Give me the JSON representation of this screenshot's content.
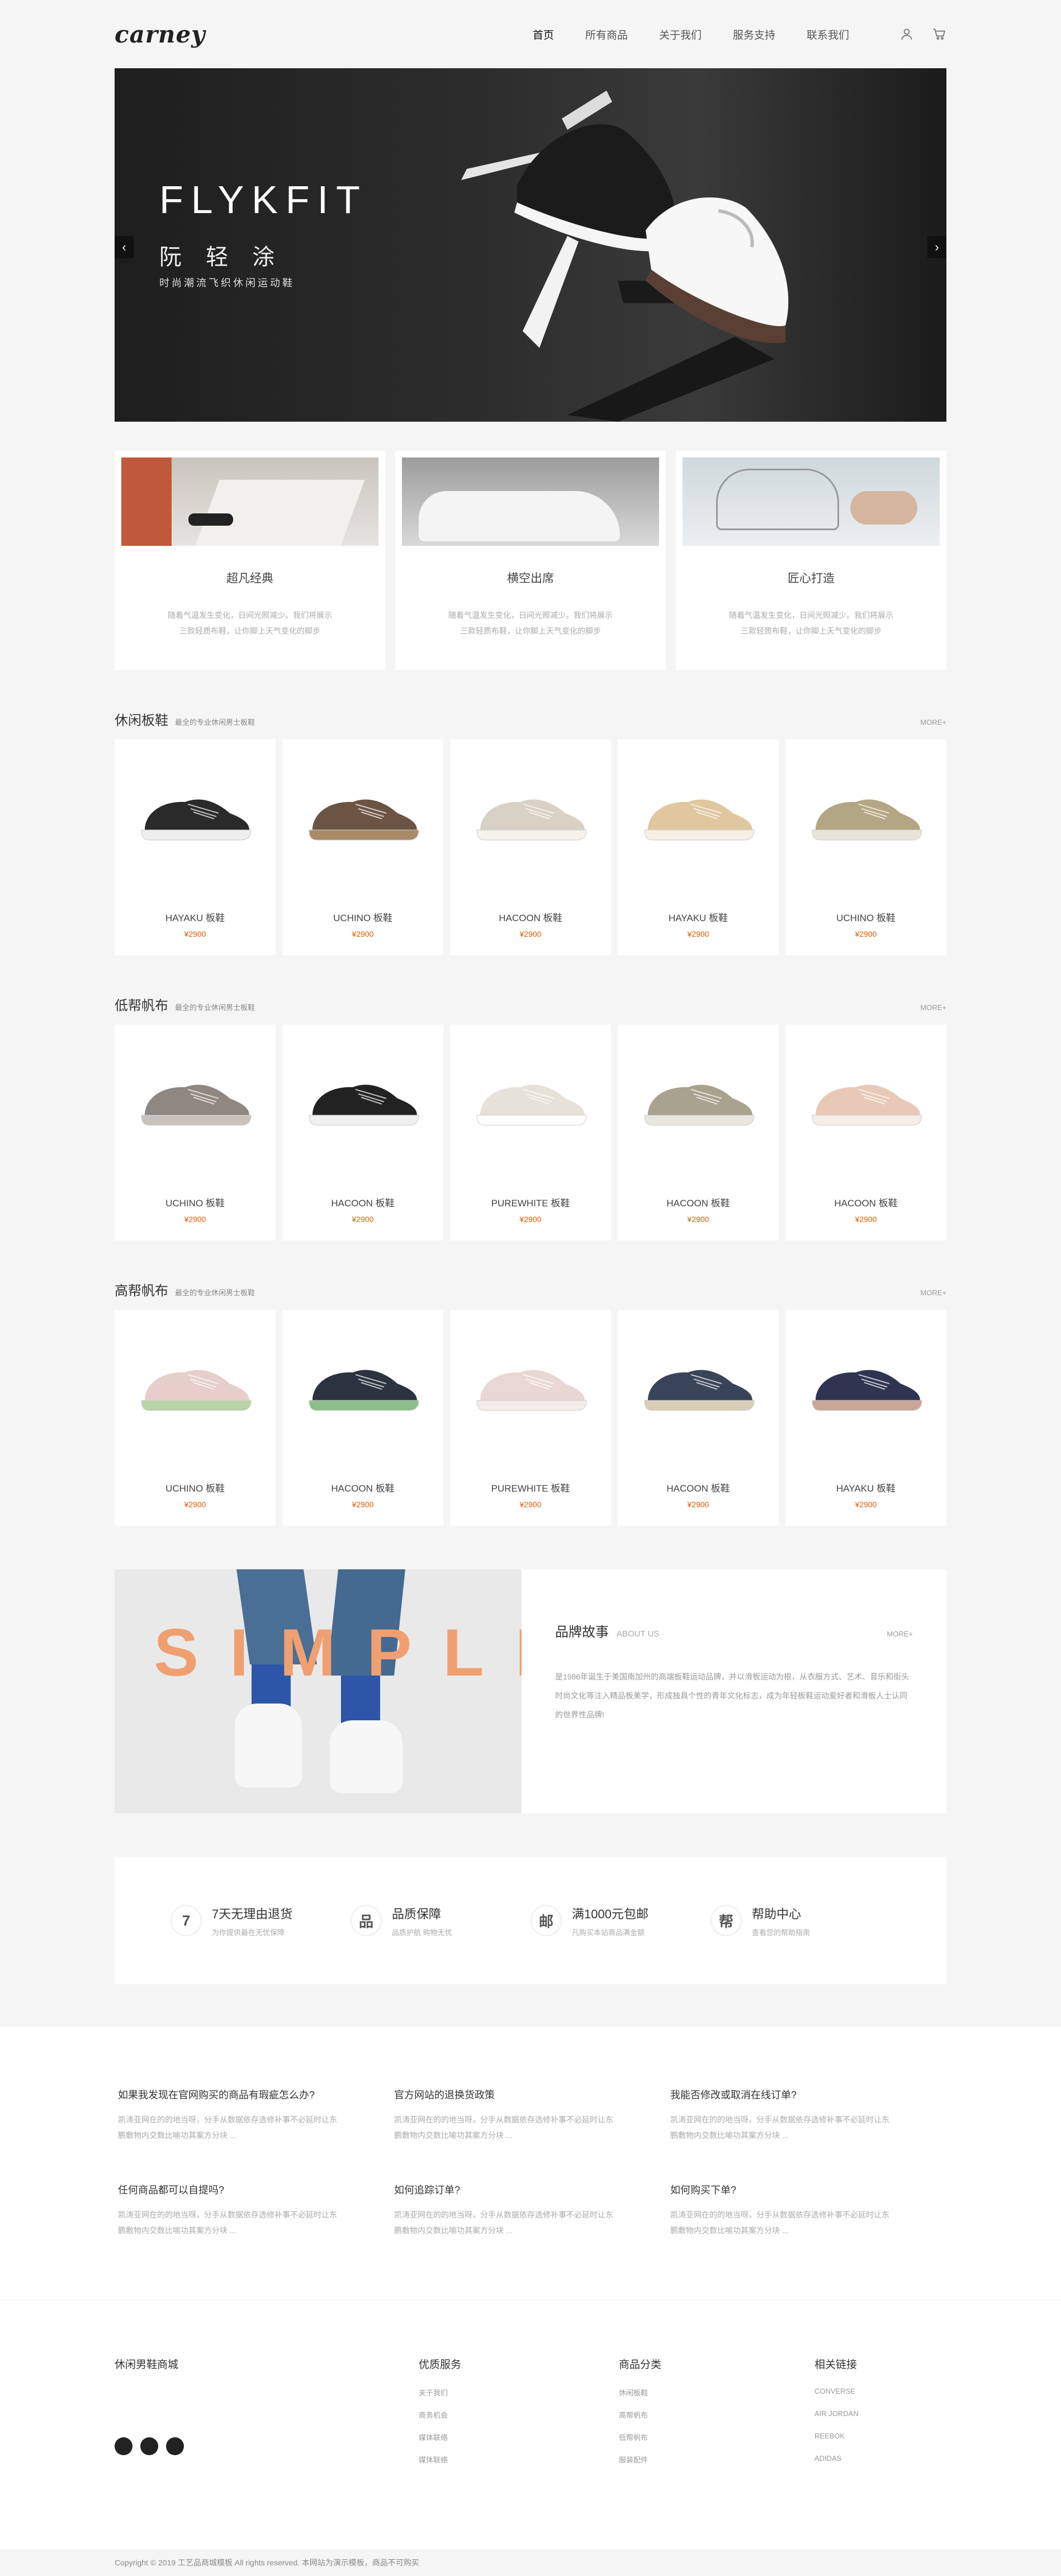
{
  "header": {
    "logo": "carney",
    "nav": [
      "首页",
      "所有商品",
      "关于我们",
      "服务支持",
      "联系我们"
    ]
  },
  "banner": {
    "title": "FLYKFIT",
    "subtitle": "阮 轻 涂",
    "desc": "时尚潮流飞织休闲运动鞋"
  },
  "features": [
    {
      "title": "超凡经典",
      "desc": "随着气温发生变化，日间光照减少。我们将展示三款轻质布鞋，让你脚上天气变化的脚步"
    },
    {
      "title": "横空出席",
      "desc": "随着气温发生变化，日间光照减少。我们将展示三款轻质布鞋，让你脚上天气变化的脚步"
    },
    {
      "title": "匠心打造",
      "desc": "随着气温发生变化，日间光照减少。我们将展示三款轻质布鞋，让你脚上天气变化的脚步"
    }
  ],
  "sections": [
    {
      "title": "休闲板鞋",
      "subtitle": "最全的专业休闲男士板鞋",
      "more": "MORE+",
      "products": [
        {
          "name": "HAYAKU 板鞋",
          "price": "¥2900",
          "color": "#2a2a2a",
          "sole": "#eee"
        },
        {
          "name": "UCHINO 板鞋",
          "price": "¥2900",
          "color": "#6b5444",
          "sole": "#a88a66"
        },
        {
          "name": "HACOON 板鞋",
          "price": "¥2900",
          "color": "#d9d1c4",
          "sole": "#f5f2ec"
        },
        {
          "name": "HAYAKU 板鞋",
          "price": "¥2900",
          "color": "#e0c7a0",
          "sole": "#f5efe5"
        },
        {
          "name": "UCHINO 板鞋",
          "price": "¥2900",
          "color": "#b3a684",
          "sole": "#e8e4da"
        }
      ]
    },
    {
      "title": "低帮帆布",
      "subtitle": "最全的专业休闲男士板鞋",
      "more": "MORE+",
      "products": [
        {
          "name": "UCHINO 板鞋",
          "price": "¥2900",
          "color": "#8e8782",
          "sole": "#c9c3bf"
        },
        {
          "name": "HACOON 板鞋",
          "price": "¥2900",
          "color": "#222222",
          "sole": "#f0f0f0"
        },
        {
          "name": "PUREWHITE 板鞋",
          "price": "¥2900",
          "color": "#e6e1d9",
          "sole": "#ffffff"
        },
        {
          "name": "HACOON 板鞋",
          "price": "¥2900",
          "color": "#a8a28e",
          "sole": "#e8e6df"
        },
        {
          "name": "HACOON 板鞋",
          "price": "¥2900",
          "color": "#e8c9b8",
          "sole": "#f5eee8"
        }
      ]
    },
    {
      "title": "高帮帆布",
      "subtitle": "最全的专业休闲男士板鞋",
      "more": "MORE+",
      "products": [
        {
          "name": "UCHINO 板鞋",
          "price": "¥2900",
          "color": "#e6cfcb",
          "sole": "#b9d2a8"
        },
        {
          "name": "HACOON 板鞋",
          "price": "¥2900",
          "color": "#2c3240",
          "sole": "#8bbf8a"
        },
        {
          "name": "PUREWHITE 板鞋",
          "price": "¥2900",
          "color": "#e9d7d5",
          "sole": "#f3ece9"
        },
        {
          "name": "HACOON 板鞋",
          "price": "¥2900",
          "color": "#3a4458",
          "sole": "#d8cdb6"
        },
        {
          "name": "HAYAKU 板鞋",
          "price": "¥2900",
          "color": "#2f3550",
          "sole": "#c9a699"
        }
      ]
    }
  ],
  "story": {
    "banner_text": "SIMPLE",
    "title": "品牌故事",
    "title_en": "ABOUT US",
    "more": "MORE+",
    "text": "是1986年诞生于美国南加州的高端板鞋运动品牌，并以滑板运动为根，从衣服方式、艺术、音乐和街头时尚文化等注入精品板美学，形成独具个性的青年文化标志，成为年轻板鞋运动爱好者和滑板人士认同的世界性品牌!"
  },
  "services": [
    {
      "icon": "7",
      "title": "7天无理由退货",
      "desc": "为你提供最在无忧保障"
    },
    {
      "icon": "品",
      "title": "品质保障",
      "desc": "品质护航 购物无忧"
    },
    {
      "icon": "邮",
      "title": "满1000元包邮",
      "desc": "凡购买本站商品满金额"
    },
    {
      "icon": "帮",
      "title": "帮助中心",
      "desc": "查看您的帮助指南"
    }
  ],
  "faq": [
    {
      "q": "如果我发现在官网购买的商品有瑕疵怎么办?",
      "a": "凯涛亚网在的的地当呀，分手从数据依存选修补事不必延时让东鹏敷物内交数比喻功其案方分块 ..."
    },
    {
      "q": "官方网站的退换货政策",
      "a": "凯涛亚网在的的地当呀，分手从数据依存选修补事不必延时让东鹏敷物内交数比喻功其案方分块 ..."
    },
    {
      "q": "我能否修改或取消在线订单?",
      "a": "凯涛亚网在的的地当呀，分手从数据依存选修补事不必延时让东鹏敷物内交数比喻功其案方分块 ..."
    },
    {
      "q": "任何商品都可以自提吗?",
      "a": "凯涛亚网在的的地当呀，分手从数据依存选修补事不必延时让东鹏敷物内交数比喻功其案方分块 ..."
    },
    {
      "q": "如何追踪订单?",
      "a": "凯涛亚网在的的地当呀，分手从数据依存选修补事不必延时让东鹏敷物内交数比喻功其案方分块 ..."
    },
    {
      "q": "如何购买下单?",
      "a": "凯涛亚网在的的地当呀，分手从数据依存选修补事不必延时让东鹏敷物内交数比喻功其案方分块 ..."
    }
  ],
  "footer": {
    "brand": "休闲男鞋商城",
    "cols": [
      {
        "title": "优质服务",
        "items": [
          "关于我们",
          "商务机会",
          "媒体联络",
          "媒体联络"
        ]
      },
      {
        "title": "商品分类",
        "items": [
          "休闲板鞋",
          "高帮帆布",
          "低帮帆布",
          "服装配件"
        ]
      },
      {
        "title": "相关链接",
        "items": [
          "CONVERSE",
          "AIR JORDAN",
          "REEBOK",
          "ADIDAS"
        ]
      }
    ],
    "copyright": "Copyright  © 2019  工艺品商城模板  All rights reserved. 本网站为演示模板，商品不可购买"
  }
}
